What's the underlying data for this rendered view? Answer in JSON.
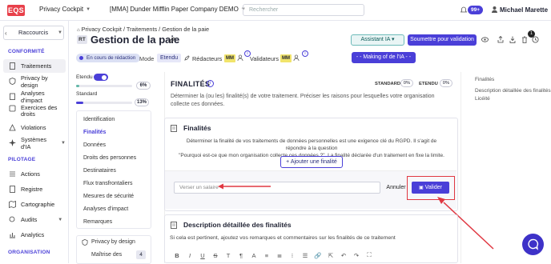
{
  "topbar": {
    "logo": "EQS",
    "menu1": "Privacy Cockpit",
    "menu2": "[MMA] Dunder Mifflin Paper Company DEMO",
    "search_placeholder": "Rechercher",
    "notif_count": "99+",
    "user_name": "Michael Marette"
  },
  "sidebar": {
    "shortcuts": "Raccourcis",
    "section1": "CONFORMITÉ",
    "items1": [
      "Traitements",
      "Privacy by design",
      "Analyses d'impact",
      "Exercices des droits",
      "Violations",
      "Systèmes d'IA"
    ],
    "section2": "PILOTAGE",
    "items2": [
      "Actions",
      "Registre",
      "Cartographie",
      "Audits",
      "Analytics"
    ],
    "section3": "ORGANISATION"
  },
  "header": {
    "crumb1": "Privacy Cockpit",
    "crumb2": "Traitements",
    "crumb3": "Gestion de la paie",
    "tag": "RT",
    "title": "Gestion de la paie",
    "assistant_label": "Assistant IA",
    "submit_label": "Soumettre pour validation",
    "notif_small": "1",
    "status": "En cours de rédaction",
    "mode_label": "Mode",
    "mode_value": "Etendu",
    "redacteurs_label": "Rédacteurs",
    "validateurs_label": "Validateurs",
    "avatar1": "MM",
    "avatar2": "MM",
    "making_label": "- - Making of de l'IA - -"
  },
  "progress": {
    "etendu_label": "Etendu",
    "etendu_pct": "6%",
    "etendu_value": 6,
    "standard_label": "Standard",
    "standard_pct": "13%",
    "standard_value": 13
  },
  "sections": [
    "Identification",
    "Finalités",
    "Données",
    "Droits des personnes",
    "Destinataires",
    "Flux transfrontaliers",
    "Mesures de sécurité",
    "Analyses d'impact",
    "Remarques"
  ],
  "bottom": {
    "item1": "Privacy by design",
    "item2": "Maîtrise des",
    "count": "4"
  },
  "finalites": {
    "title": "FINALITÉS",
    "standard_label": "STANDARD",
    "standard_pct": "0%",
    "etendu_label": "ETENDU",
    "etendu_pct": "0%",
    "description": "Déterminer la (ou les) finalité(s) de votre traitement. Préciser les raisons pour lesquelles votre organisation collecte ces données.",
    "card_title": "Finalités",
    "card_text_1": "Déterminer la finalité de vos traitements de données personnelles est une exigence clé du RGPD. Il s'agit de répondre à la question",
    "card_text_2": "\"Pourquoi est-ce que mon organisation collecte ces données ?\". La finalité déclarée d'un traitement en fixe la limite.",
    "add_label": "Ajouter une finalité",
    "input_value": "Verser un salaire",
    "cancel_label": "Annuler",
    "validate_label": "Valider"
  },
  "desc_card": {
    "title": "Description détaillée des finalités",
    "text": "Si cela est pertinent, ajoutez vos remarques et commentaires sur les finalités de ce traitement"
  },
  "toolbar": [
    "B",
    "I",
    "U",
    "S",
    "T",
    "¶",
    "A",
    "≡",
    "≣",
    "⁝",
    "☰",
    "🔗",
    "⇱",
    "↶",
    "↷",
    "⛶"
  ],
  "toc": {
    "item1": "Finalités",
    "item2": "Description détaillée des finalités",
    "item3": "Licéité"
  },
  "colors": {
    "accent": "#4a3fd8",
    "teal": "#0c5c5a",
    "red_annotation": "#e03842"
  }
}
